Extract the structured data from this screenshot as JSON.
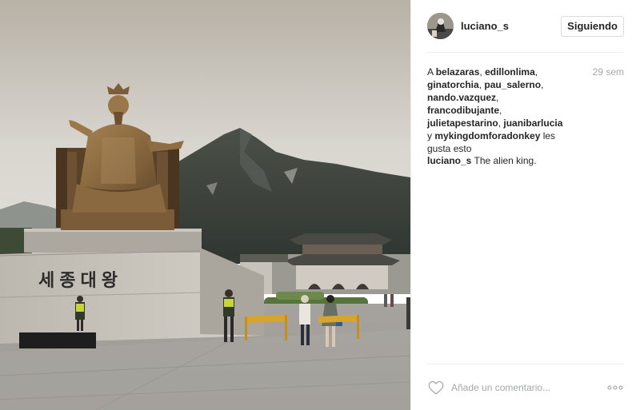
{
  "post": {
    "photo_alt": "",
    "statue_inscription": "세종대왕"
  },
  "header": {
    "username": "luciano_s",
    "follow_label": "Siguiendo"
  },
  "likes": {
    "prefix": "A ",
    "users": [
      "belazaras",
      "edillonlima",
      "ginatorchia",
      "pau_salerno",
      "nando.vazquez",
      "francodibujante",
      "julietapestarino",
      "juanibarlucia",
      "mykingdomforadonkey"
    ],
    "separator": ", ",
    "conjunction": " y ",
    "suffix": " les gusta esto"
  },
  "timestamp": "29 sem",
  "caption": {
    "username": "luciano_s",
    "text": "The alien king."
  },
  "comment": {
    "placeholder": "Añade un comentario..."
  },
  "icons": {
    "like": "heart-icon",
    "more": "more-options-icon"
  }
}
